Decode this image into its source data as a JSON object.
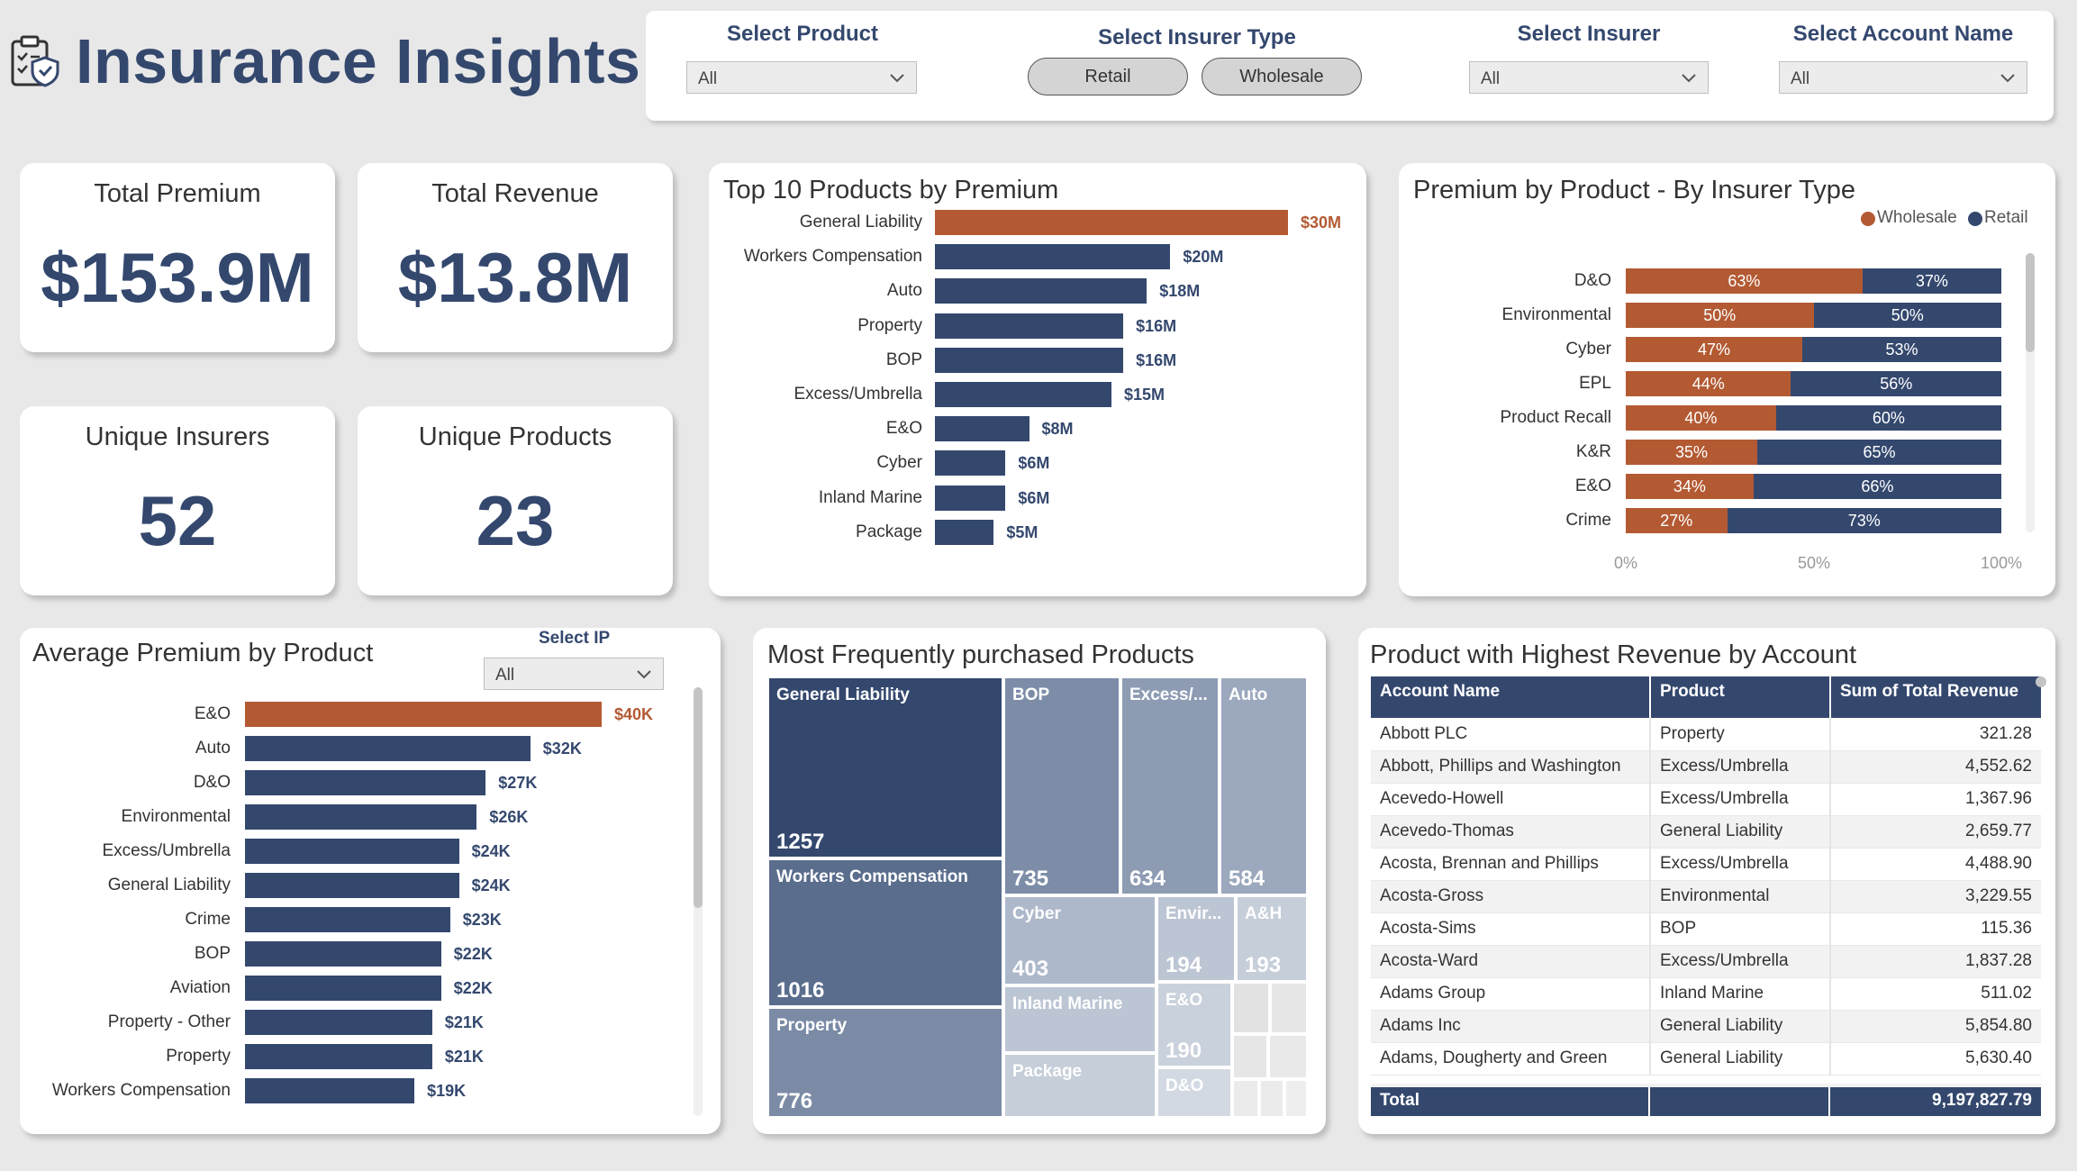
{
  "header": {
    "title": "Insurance Insights",
    "icon": "clipboard-shield-icon"
  },
  "filters": {
    "product": {
      "label": "Select Product",
      "value": "All"
    },
    "insurer_type": {
      "label": "Select Insurer Type",
      "options": [
        "Retail",
        "Wholesale"
      ]
    },
    "insurer": {
      "label": "Select Insurer",
      "value": "All"
    },
    "account": {
      "label": "Select Account Name",
      "value": "All"
    }
  },
  "kpis": {
    "total_premium": {
      "label": "Total Premium",
      "value": "$153.9M"
    },
    "total_revenue": {
      "label": "Total Revenue",
      "value": "$13.8M"
    },
    "unique_insurers": {
      "label": "Unique Insurers",
      "value": "52"
    },
    "unique_products": {
      "label": "Unique Products",
      "value": "23"
    }
  },
  "colors": {
    "accent": "#b35a33",
    "primary": "#34486e"
  },
  "top10": {
    "title": "Top 10 Products by Premium",
    "chart_data": {
      "type": "bar",
      "categories": [
        "General Liability",
        "Workers Compensation",
        "Auto",
        "Property",
        "BOP",
        "Excess/Umbrella",
        "E&O",
        "Cyber",
        "Inland Marine",
        "Package"
      ],
      "values": [
        30,
        20,
        18,
        16,
        16,
        15,
        8,
        6,
        6,
        5
      ],
      "labels": [
        "$30M",
        "$20M",
        "$18M",
        "$16M",
        "$16M",
        "$15M",
        "$8M",
        "$6M",
        "$6M",
        "$5M"
      ]
    }
  },
  "stacked": {
    "title": "Premium by Product - By Insurer Type",
    "legend": [
      "Wholesale",
      "Retail"
    ],
    "axis_ticks": [
      "0%",
      "50%",
      "100%"
    ],
    "chart_data": {
      "type": "bar",
      "categories": [
        "D&O",
        "Environmental",
        "Cyber",
        "EPL",
        "Product Recall",
        "K&R",
        "E&O",
        "Crime"
      ],
      "series": [
        {
          "name": "Wholesale",
          "values": [
            63,
            50,
            47,
            44,
            40,
            35,
            34,
            27
          ]
        },
        {
          "name": "Retail",
          "values": [
            37,
            50,
            53,
            56,
            60,
            65,
            66,
            73
          ]
        }
      ],
      "xlim": [
        0,
        100
      ]
    }
  },
  "avg": {
    "title": "Average Premium by Product",
    "filter_label": "Select IP",
    "filter_value": "All",
    "chart_data": {
      "type": "bar",
      "categories": [
        "E&O",
        "Auto",
        "D&O",
        "Environmental",
        "Excess/Umbrella",
        "General Liability",
        "Crime",
        "BOP",
        "Aviation",
        "Property - Other",
        "Property",
        "Workers Compensation"
      ],
      "values": [
        40,
        32,
        27,
        26,
        24,
        24,
        23,
        22,
        22,
        21,
        21,
        19
      ],
      "labels": [
        "$40K",
        "$32K",
        "$27K",
        "$26K",
        "$24K",
        "$24K",
        "$23K",
        "$22K",
        "$22K",
        "$21K",
        "$21K",
        "$19K"
      ]
    }
  },
  "treemap": {
    "title": "Most Frequently purchased Products",
    "tiles": [
      {
        "name": "General Liability",
        "value": "1257"
      },
      {
        "name": "Workers Compensation",
        "value": "1016"
      },
      {
        "name": "Property",
        "value": "776"
      },
      {
        "name": "BOP",
        "value": "735"
      },
      {
        "name": "Excess/...",
        "value": "634"
      },
      {
        "name": "Auto",
        "value": "584"
      },
      {
        "name": "Cyber",
        "value": "403"
      },
      {
        "name": "Envir...",
        "value": "194"
      },
      {
        "name": "A&H",
        "value": "193"
      },
      {
        "name": "Inland Marine",
        "value": ""
      },
      {
        "name": "E&O",
        "value": "190"
      },
      {
        "name": "Package",
        "value": ""
      },
      {
        "name": "D&O",
        "value": ""
      }
    ]
  },
  "table": {
    "title": "Product with Highest Revenue by Account",
    "columns": [
      "Account Name",
      "Product",
      "Sum of Total Revenue"
    ],
    "rows": [
      [
        "Abbott PLC",
        "Property",
        "321.28"
      ],
      [
        "Abbott, Phillips and Washington",
        "Excess/Umbrella",
        "4,552.62"
      ],
      [
        "Acevedo-Howell",
        "Excess/Umbrella",
        "1,367.96"
      ],
      [
        "Acevedo-Thomas",
        "General Liability",
        "2,659.77"
      ],
      [
        "Acosta, Brennan and Phillips",
        "Excess/Umbrella",
        "4,488.90"
      ],
      [
        "Acosta-Gross",
        "Environmental",
        "3,229.55"
      ],
      [
        "Acosta-Sims",
        "BOP",
        "115.36"
      ],
      [
        "Acosta-Ward",
        "Excess/Umbrella",
        "1,837.28"
      ],
      [
        "Adams Group",
        "Inland Marine",
        "511.02"
      ],
      [
        "Adams Inc",
        "General Liability",
        "5,854.80"
      ],
      [
        "Adams, Dougherty and Green",
        "General Liability",
        "5,630.40"
      ]
    ],
    "total_label": "Total",
    "total_value": "9,197,827.79"
  }
}
